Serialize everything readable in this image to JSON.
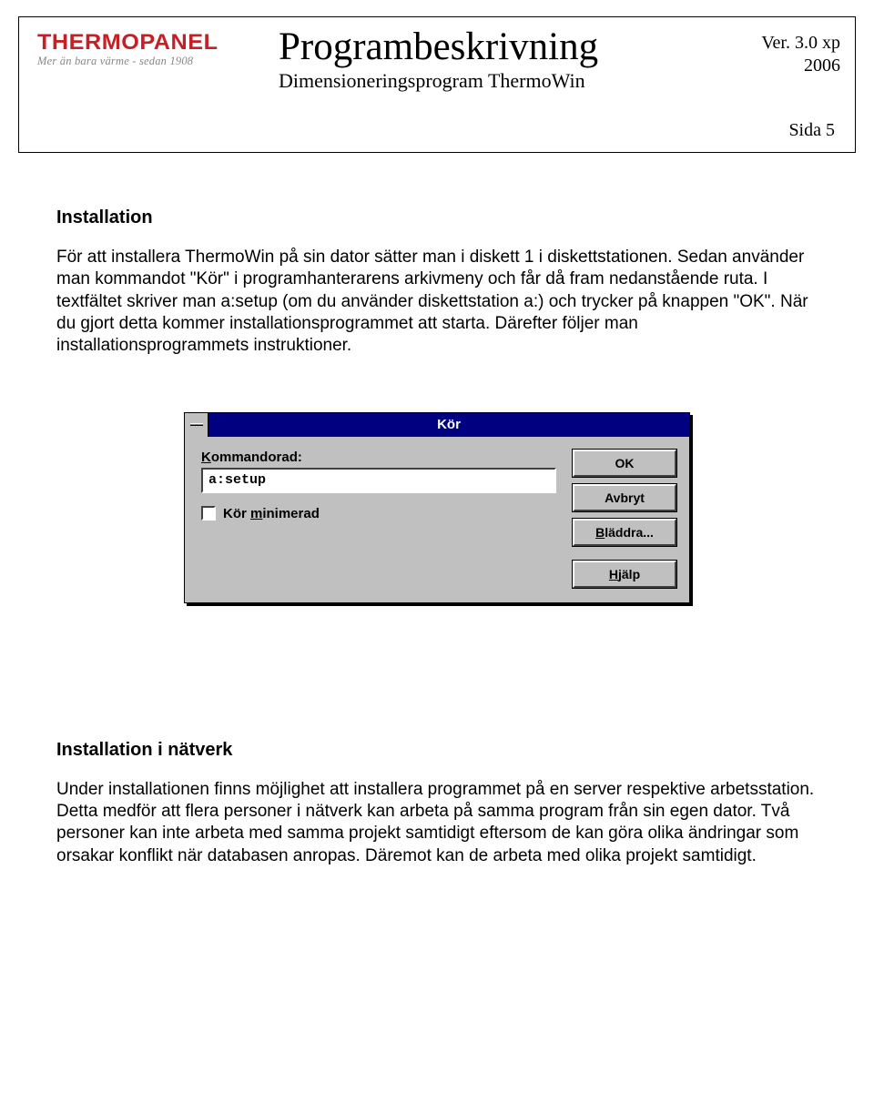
{
  "header": {
    "logo_text": "THERMOPANEL",
    "logo_tagline": "Mer än bara värme - sedan 1908",
    "title": "Programbeskrivning",
    "subtitle": "Dimensioneringsprogram ThermoWin",
    "version_line": "Ver. 3.0 xp",
    "year": "2006",
    "page_label": "Sida 5"
  },
  "section1": {
    "heading": "Installation",
    "body": "För att installera ThermoWin på sin dator sätter man i diskett 1 i diskettstationen. Sedan använder man kommandot \"Kör\" i programhanterarens arkivmeny och får då fram nedanstående ruta. I textfältet skriver man a:setup (om du använder diskettstation a:) och trycker på knappen \"OK\". När du gjort detta kommer installationsprogrammet att starta. Därefter följer man installationsprogrammets instruktioner."
  },
  "dialog": {
    "title": "Kör",
    "field_label_pre": "K",
    "field_label_post": "ommandorad:",
    "input_value": "a:setup",
    "checkbox_pre": "Kör ",
    "checkbox_u": "m",
    "checkbox_post": "inimerad",
    "buttons": {
      "ok": "OK",
      "cancel": "Avbryt",
      "browse_pre": "B",
      "browse_post": "läddra...",
      "help_pre": "H",
      "help_post": "jälp"
    }
  },
  "section2": {
    "heading": "Installation i nätverk",
    "body": "Under installationen finns möjlighet att installera programmet på en server respektive arbetsstation. Detta medför att flera personer i nätverk kan arbeta på samma program från sin egen dator. Två personer kan inte arbeta med samma projekt samtidigt eftersom de kan göra olika ändringar som orsakar konflikt när databasen anropas. Däremot kan de arbeta med olika projekt samtidigt."
  }
}
